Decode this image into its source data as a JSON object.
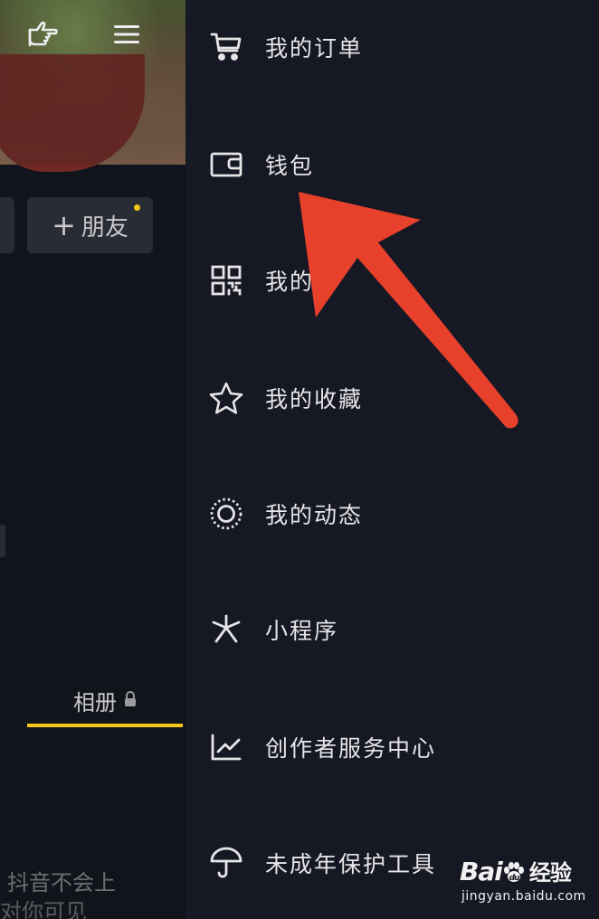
{
  "profile": {
    "add_friend_label": "朋友",
    "album_tab_label": "相册",
    "bottom_text_line1": "抖音不会上",
    "bottom_text_line2": "对你可见"
  },
  "drawer": {
    "items": [
      {
        "label": "我的订单",
        "icon": "cart-icon"
      },
      {
        "label": "钱包",
        "icon": "wallet-icon"
      },
      {
        "label": "我的",
        "icon": "qr-code-icon"
      },
      {
        "label": "我的收藏",
        "icon": "star-icon"
      },
      {
        "label": "我的动态",
        "icon": "moments-icon"
      },
      {
        "label": "小程序",
        "icon": "mini-program-icon"
      },
      {
        "label": "创作者服务中心",
        "icon": "chart-icon"
      },
      {
        "label": "未成年保护工具",
        "icon": "umbrella-icon"
      }
    ]
  },
  "annotation": {
    "arrow_color": "#e8412b"
  },
  "watermark": {
    "brand": "Bai",
    "brand_suffix": "经验",
    "url": "jingyan.baidu.com"
  },
  "colors": {
    "background": "#161823",
    "accent": "#f5c518"
  }
}
